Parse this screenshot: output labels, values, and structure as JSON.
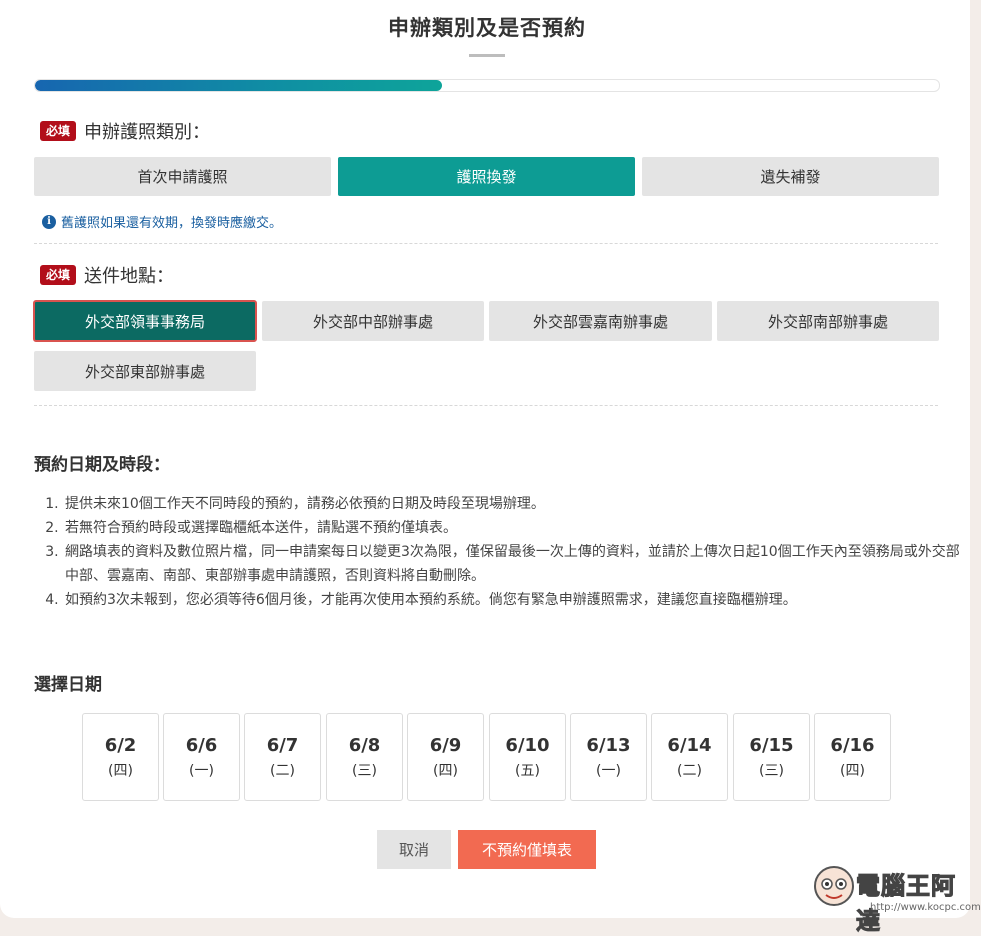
{
  "page": {
    "title": "申辦類別及是否預約"
  },
  "progress": {
    "percent": 45
  },
  "passport_type": {
    "badge": "必填",
    "label": "申辦護照類別：",
    "options": [
      "首次申請護照",
      "護照換發",
      "遺失補發"
    ],
    "selected": "護照換發",
    "hint": "舊護照如果還有效期，換發時應繳交。"
  },
  "delivery": {
    "badge": "必填",
    "label": "送件地點：",
    "options": [
      "外交部領事事務局",
      "外交部中部辦事處",
      "外交部雲嘉南辦事處",
      "外交部南部辦事處",
      "外交部東部辦事處"
    ],
    "selected": "外交部領事事務局"
  },
  "appointment": {
    "heading": "預約日期及時段：",
    "notes": [
      "提供未來10個工作天不同時段的預約，請務必依預約日期及時段至現場辦理。",
      "若無符合預約時段或選擇臨櫃紙本送件，請點選不預約僅填表。",
      "網路填表的資料及數位照片檔，同一申請案每日以變更3次為限，僅保留最後一次上傳的資料，並請於上傳次日起10個工作天內至領務局或外交部中部、雲嘉南、南部、東部辦事處申請護照，否則資料將自動刪除。",
      "如預約3次未報到，您必須等待6個月後，才能再次使用本預約系統。倘您有緊急申辦護照需求，建議您直接臨櫃辦理。"
    ]
  },
  "date_select": {
    "heading": "選擇日期",
    "dates": [
      {
        "date": "6/2",
        "weekday": "(四)"
      },
      {
        "date": "6/6",
        "weekday": "(一)"
      },
      {
        "date": "6/7",
        "weekday": "(二)"
      },
      {
        "date": "6/8",
        "weekday": "(三)"
      },
      {
        "date": "6/9",
        "weekday": "(四)"
      },
      {
        "date": "6/10",
        "weekday": "(五)"
      },
      {
        "date": "6/13",
        "weekday": "(一)"
      },
      {
        "date": "6/14",
        "weekday": "(二)"
      },
      {
        "date": "6/15",
        "weekday": "(三)"
      },
      {
        "date": "6/16",
        "weekday": "(四)"
      }
    ]
  },
  "actions": {
    "cancel": "取消",
    "no_booking": "不預約僅填表"
  },
  "watermark": {
    "text": "電腦王阿達",
    "url": "http://www.kocpc.com.tw"
  },
  "colors": {
    "teal": "#0d9c94",
    "dark_teal": "#0c6a62",
    "required_red": "#b20e1a",
    "orange": "#f26a51",
    "link_blue": "#1a5fa0"
  }
}
